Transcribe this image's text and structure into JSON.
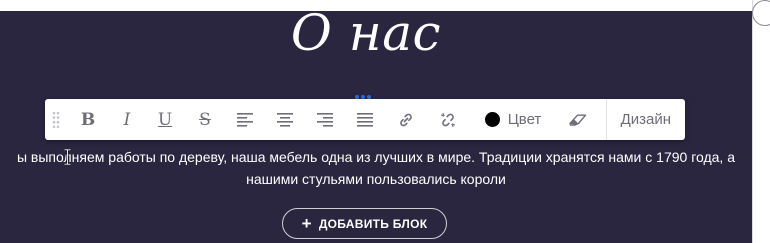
{
  "section": {
    "title": "О нас",
    "text_line1": "ы выполняем работы по дереву, наша мебель одна из лучших в мире. Традиции хранятся нами с 1790 года, а",
    "text_line2": "нашими стульями пользовались короли",
    "background_color": "#2a2640"
  },
  "toolbar": {
    "bold_label": "B",
    "italic_label": "I",
    "underline_label": "U",
    "strike_label": "S",
    "color_label": "Цвет",
    "color_value": "#000000",
    "design_label": "Дизайн",
    "icons": [
      "drag-handle-icon",
      "align-left-icon",
      "align-center-icon",
      "align-right-icon",
      "align-justify-icon",
      "link-icon",
      "unlink-icon",
      "eraser-icon"
    ]
  },
  "add_block": {
    "label": "ДОБАВИТЬ БЛОК"
  }
}
